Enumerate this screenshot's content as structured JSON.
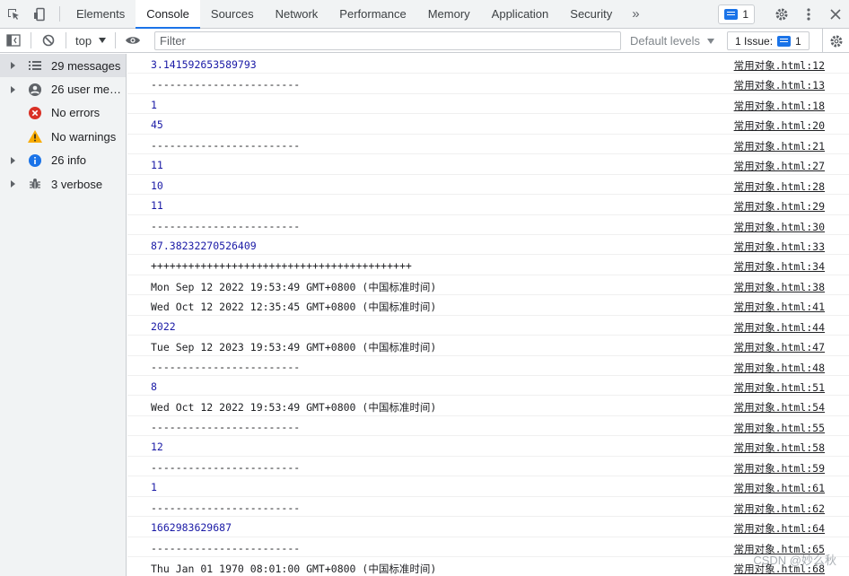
{
  "tabs": [
    {
      "label": "Elements",
      "active": false
    },
    {
      "label": "Console",
      "active": true
    },
    {
      "label": "Sources",
      "active": false
    },
    {
      "label": "Network",
      "active": false
    },
    {
      "label": "Performance",
      "active": false
    },
    {
      "label": "Memory",
      "active": false
    },
    {
      "label": "Application",
      "active": false
    },
    {
      "label": "Security",
      "active": false
    }
  ],
  "tabbar": {
    "more_label": "»",
    "issues_count": "1"
  },
  "toolbar": {
    "context": "top",
    "filter_placeholder": "Filter",
    "levels_label": "Default levels",
    "issues_label": "1 Issue:",
    "issues_count": "1"
  },
  "sidebar": {
    "items": [
      {
        "label": "29 messages",
        "icon": "list-icon",
        "expandable": true,
        "selected": true
      },
      {
        "label": "26 user mes…",
        "icon": "user-icon",
        "expandable": true,
        "selected": false
      },
      {
        "label": "No errors",
        "icon": "error-icon",
        "expandable": false,
        "selected": false
      },
      {
        "label": "No warnings",
        "icon": "warning-icon",
        "expandable": false,
        "selected": false
      },
      {
        "label": "26 info",
        "icon": "info-icon",
        "expandable": true,
        "selected": false
      },
      {
        "label": "3 verbose",
        "icon": "bug-icon",
        "expandable": true,
        "selected": false
      }
    ]
  },
  "logs": [
    {
      "text": "3.141592653589793",
      "src": "常用对象.html:12",
      "type": "number"
    },
    {
      "text": "------------------------",
      "src": "常用对象.html:13",
      "type": "string"
    },
    {
      "text": "1",
      "src": "常用对象.html:18",
      "type": "number"
    },
    {
      "text": "45",
      "src": "常用对象.html:20",
      "type": "number"
    },
    {
      "text": "------------------------",
      "src": "常用对象.html:21",
      "type": "string"
    },
    {
      "text": "11",
      "src": "常用对象.html:27",
      "type": "number"
    },
    {
      "text": "10",
      "src": "常用对象.html:28",
      "type": "number"
    },
    {
      "text": "11",
      "src": "常用对象.html:29",
      "type": "number"
    },
    {
      "text": "------------------------",
      "src": "常用对象.html:30",
      "type": "string"
    },
    {
      "text": "87.38232270526409",
      "src": "常用对象.html:33",
      "type": "number"
    },
    {
      "text": "++++++++++++++++++++++++++++++++++++++++++",
      "src": "常用对象.html:34",
      "type": "string"
    },
    {
      "text": "Mon Sep 12 2022 19:53:49 GMT+0800 (中国标准时间)",
      "src": "常用对象.html:38",
      "type": "string"
    },
    {
      "text": "Wed Oct 12 2022 12:35:45 GMT+0800 (中国标准时间)",
      "src": "常用对象.html:41",
      "type": "string"
    },
    {
      "text": "2022",
      "src": "常用对象.html:44",
      "type": "number"
    },
    {
      "text": "Tue Sep 12 2023 19:53:49 GMT+0800 (中国标准时间)",
      "src": "常用对象.html:47",
      "type": "string"
    },
    {
      "text": "------------------------",
      "src": "常用对象.html:48",
      "type": "string"
    },
    {
      "text": "8",
      "src": "常用对象.html:51",
      "type": "number"
    },
    {
      "text": "Wed Oct 12 2022 19:53:49 GMT+0800 (中国标准时间)",
      "src": "常用对象.html:54",
      "type": "string"
    },
    {
      "text": "------------------------",
      "src": "常用对象.html:55",
      "type": "string"
    },
    {
      "text": "12",
      "src": "常用对象.html:58",
      "type": "number"
    },
    {
      "text": "------------------------",
      "src": "常用对象.html:59",
      "type": "string"
    },
    {
      "text": "1",
      "src": "常用对象.html:61",
      "type": "number"
    },
    {
      "text": "------------------------",
      "src": "常用对象.html:62",
      "type": "string"
    },
    {
      "text": "1662983629687",
      "src": "常用对象.html:64",
      "type": "number"
    },
    {
      "text": "------------------------",
      "src": "常用对象.html:65",
      "type": "string"
    },
    {
      "text": "Thu Jan 01 1970 08:01:00 GMT+0800 (中国标准时间)",
      "src": "常用对象.html:68",
      "type": "string"
    }
  ],
  "watermark": "CSDN @妙么秋",
  "colors": {
    "accent": "#1a73e8",
    "number": "#1a1aa6",
    "error": "#d93025",
    "warning": "#f9ab00",
    "sidebar_bg": "#f1f3f4"
  }
}
